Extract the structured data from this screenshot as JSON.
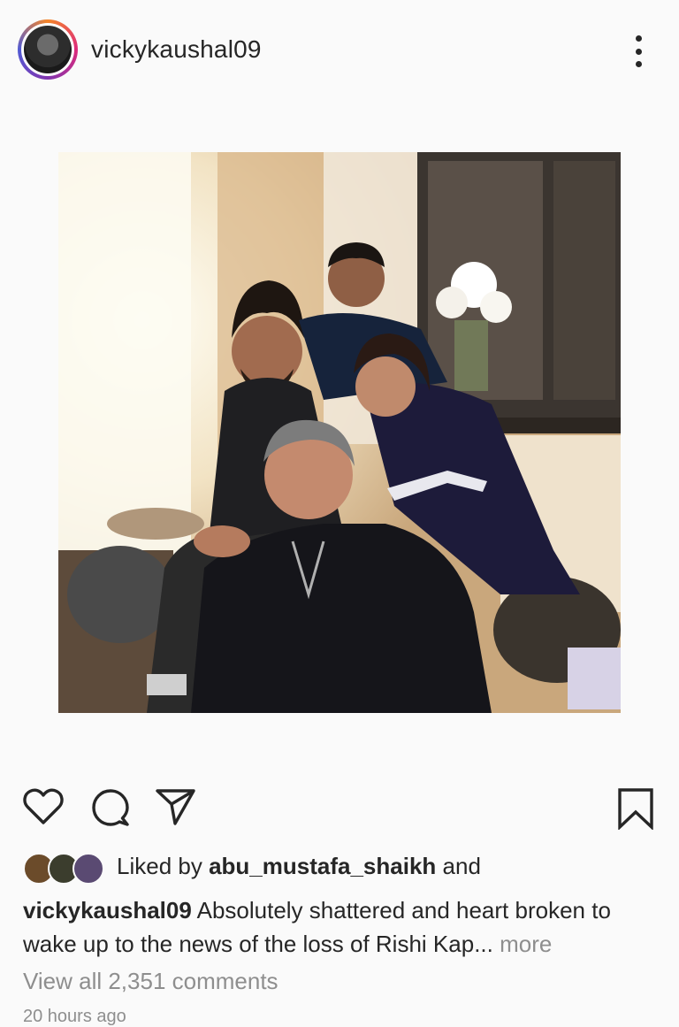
{
  "post": {
    "username": "vickykaushal09",
    "avatar_icon": "profile-avatar",
    "more_icon": "more-vertical-icon"
  },
  "actions": {
    "like_icon": "heart-icon",
    "comment_icon": "comment-icon",
    "share_icon": "send-icon",
    "save_icon": "bookmark-icon"
  },
  "likes": {
    "prefix": "Liked by ",
    "user": "abu_mustafa_shaikh",
    "suffix": " and"
  },
  "caption": {
    "username": "vickykaushal09",
    "text": " Absolutely shattered and heart broken to wake up to the news of the loss of Rishi Kap",
    "ellipsis": "...",
    "more": " more"
  },
  "comments": {
    "view_all": "View all 2,351 comments"
  },
  "timestamp": "20 hours ago",
  "colors": {
    "background": "#fafafa",
    "text": "#262626",
    "muted": "#8e8e8e"
  }
}
